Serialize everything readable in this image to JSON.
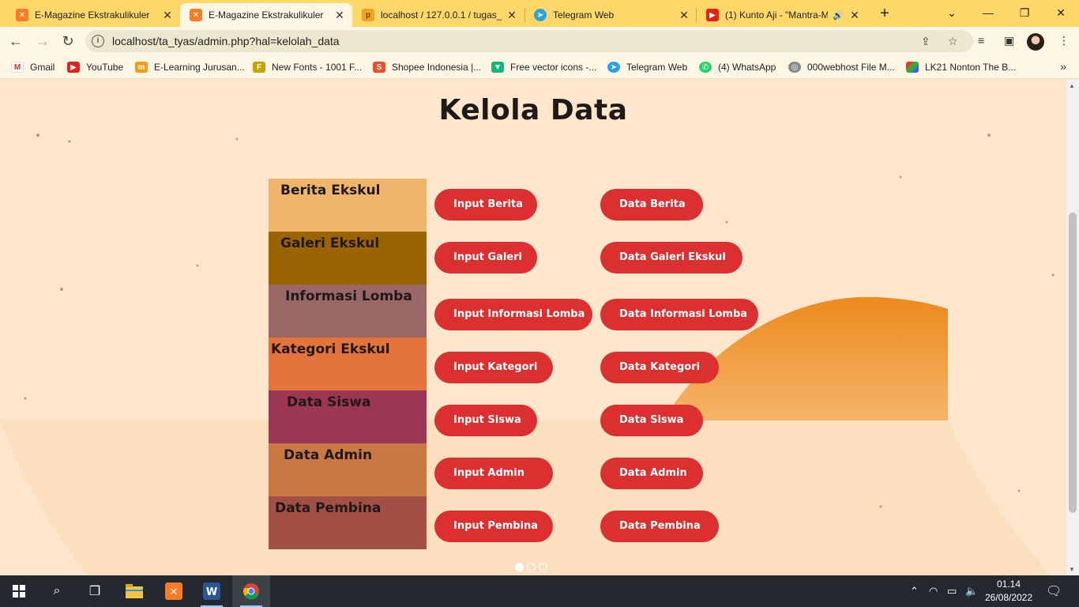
{
  "browser": {
    "tabs": [
      {
        "label": "E-Magazine Ekstrakulikuler",
        "favicon": "xampp-icon",
        "active": false
      },
      {
        "label": "E-Magazine Ekstrakulikuler",
        "favicon": "xampp-icon",
        "active": true
      },
      {
        "label": "localhost / 127.0.0.1 / tugas_",
        "favicon": "phpmyadmin-icon",
        "active": false
      },
      {
        "label": "Telegram Web",
        "favicon": "telegram-icon",
        "active": false
      },
      {
        "label": "(1) Kunto Aji - \"Mantra-M",
        "favicon": "youtube-icon",
        "active": false
      }
    ],
    "url": "localhost/ta_tyas/admin.php?hal=kelolah_data",
    "bookmarks": [
      {
        "label": "Gmail",
        "icon": "gmail-icon"
      },
      {
        "label": "YouTube",
        "icon": "youtube-icon"
      },
      {
        "label": "E-Learning Jurusan...",
        "icon": "elearning-icon"
      },
      {
        "label": "New Fonts - 1001 F...",
        "icon": "fonts-icon"
      },
      {
        "label": "Shopee Indonesia |...",
        "icon": "shopee-icon"
      },
      {
        "label": "Free vector icons -...",
        "icon": "flaticon-icon"
      },
      {
        "label": "Telegram Web",
        "icon": "telegram-icon"
      },
      {
        "label": "(4) WhatsApp",
        "icon": "whatsapp-icon"
      },
      {
        "label": "000webhost File M...",
        "icon": "webhost-icon"
      },
      {
        "label": "LK21 Nonton The B...",
        "icon": "lk21-icon"
      }
    ]
  },
  "page": {
    "title": "Kelola Data",
    "sections": [
      {
        "label": "Berita Ekskul",
        "color": "#efb56a",
        "input_button": "Input Berita",
        "data_button": "Data Berita"
      },
      {
        "label": "Galeri Ekskul",
        "color": "#9a6403",
        "input_button": "Input Galeri",
        "data_button": "Data Galeri Ekskul"
      },
      {
        "label": "Informasi Lomba",
        "color": "#9a6767",
        "input_button": "Input Informasi Lomba",
        "data_button": "Data Informasi Lomba"
      },
      {
        "label": "Kategori Ekskul",
        "color": "#e2743c",
        "input_button": "Input Kategori",
        "data_button": "Data Kategori"
      },
      {
        "label": "Data Siswa",
        "color": "#9b3654",
        "input_button": "Input Siswa",
        "data_button": "Data Siswa"
      },
      {
        "label": "Data Admin",
        "color": "#c97841",
        "input_button": "Input Admin",
        "data_button": "Data Admin"
      },
      {
        "label": "Data Pembina",
        "color": "#a24f46",
        "input_button": "Input Pembina",
        "data_button": "Data Pembina"
      }
    ],
    "accent_color": "#dc2f2f"
  },
  "taskbar": {
    "time": "01.14",
    "date": "26/08/2022",
    "apps": [
      "windows-start-icon",
      "search-icon",
      "task-view-icon",
      "file-explorer-icon",
      "xampp-icon",
      "word-icon",
      "chrome-icon"
    ]
  }
}
